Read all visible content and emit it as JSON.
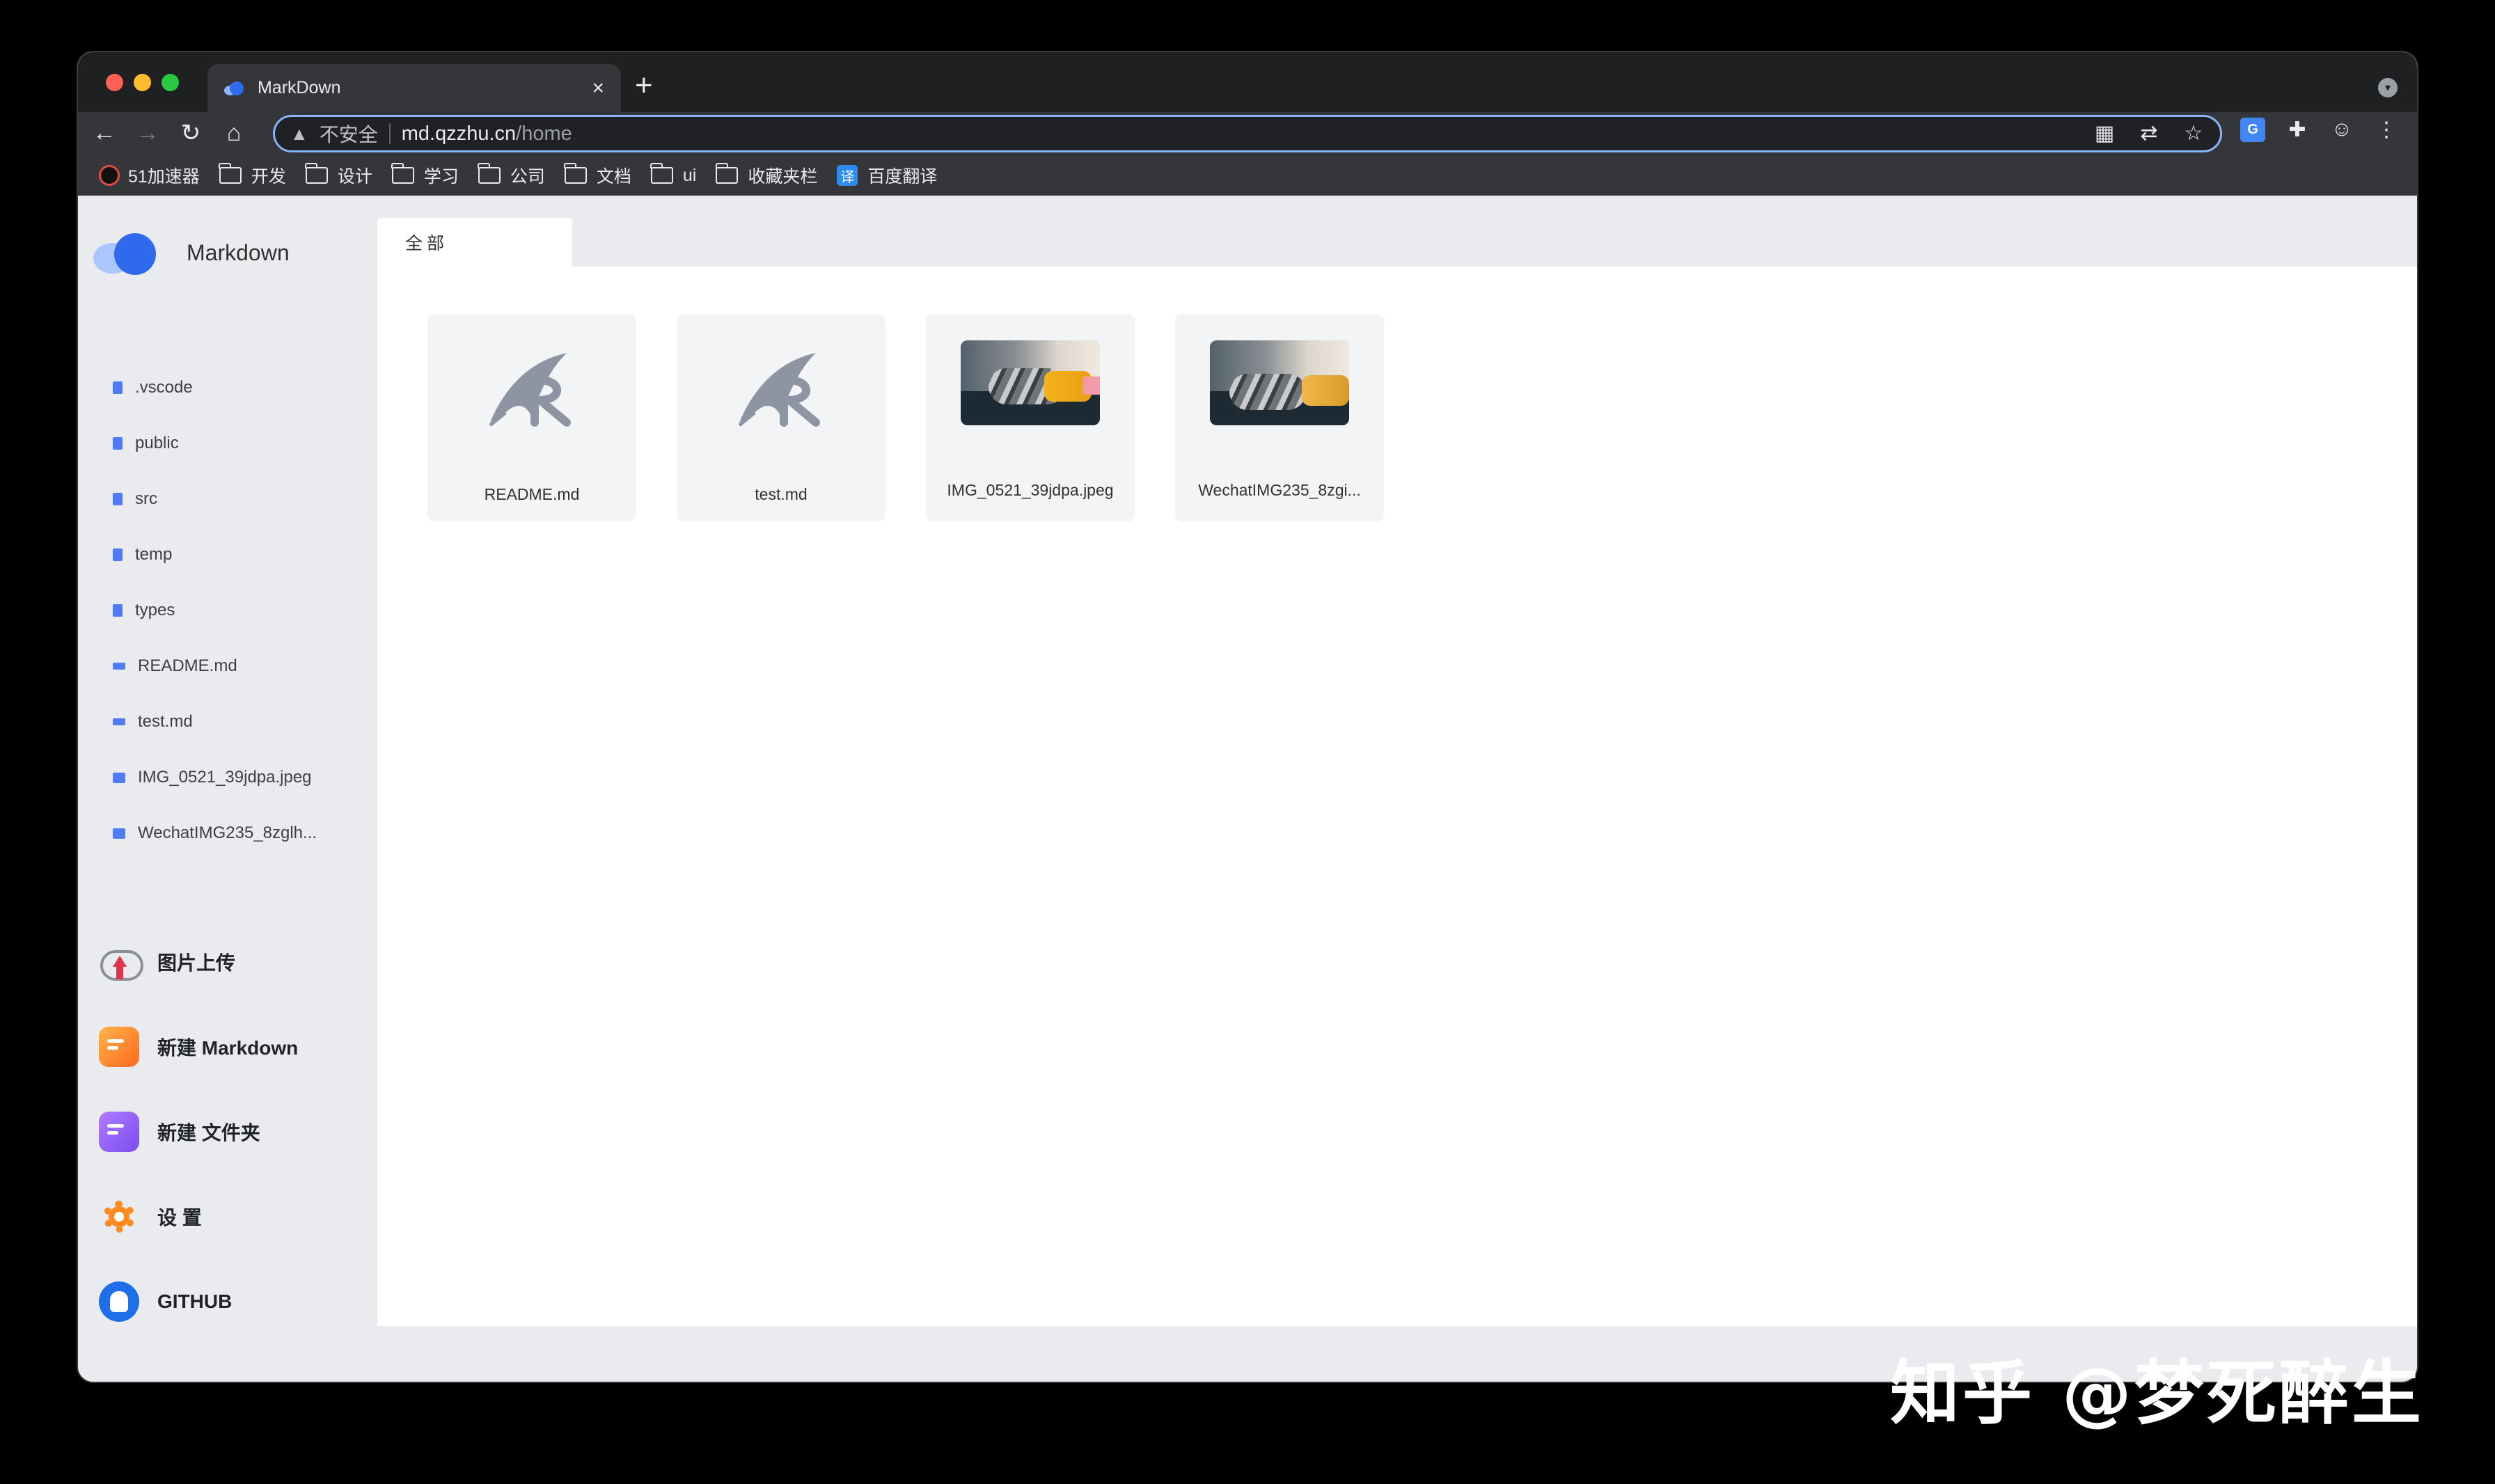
{
  "browser": {
    "tab_title": "MarkDown",
    "tab_close": "×",
    "new_tab": "+",
    "security_text": "不安全",
    "url_host": "md.qzzhu.cn",
    "url_path": "/home",
    "bookmarks": [
      {
        "label": "51加速器",
        "icon": "speed-icon"
      },
      {
        "label": "开发",
        "icon": "folder-icon"
      },
      {
        "label": "设计",
        "icon": "folder-icon"
      },
      {
        "label": "学习",
        "icon": "folder-icon"
      },
      {
        "label": "公司",
        "icon": "folder-icon"
      },
      {
        "label": "文档",
        "icon": "folder-icon"
      },
      {
        "label": "ui",
        "icon": "folder-icon"
      },
      {
        "label": "收藏夹栏",
        "icon": "folder-icon"
      },
      {
        "label": "百度翻译",
        "icon": "translate-icon"
      }
    ],
    "fanyi_glyph": "译"
  },
  "sidebar": {
    "app_title": "Markdown",
    "tree": [
      {
        "label": ".vscode",
        "icon": "file-icon"
      },
      {
        "label": "public",
        "icon": "file-icon"
      },
      {
        "label": "src",
        "icon": "file-icon"
      },
      {
        "label": "temp",
        "icon": "file-icon"
      },
      {
        "label": "types",
        "icon": "file-icon"
      },
      {
        "label": "README.md",
        "icon": "markdown-icon"
      },
      {
        "label": "test.md",
        "icon": "markdown-icon"
      },
      {
        "label": "IMG_0521_39jdpa.jpeg",
        "icon": "image-icon"
      },
      {
        "label": "WechatIMG235_8zglh...",
        "icon": "image-icon"
      }
    ],
    "actions": [
      {
        "label": "图片上传",
        "icon": "upload-icon"
      },
      {
        "label": "新建 Markdown",
        "icon": "new-markdown-icon"
      },
      {
        "label": "新建 文件夹",
        "icon": "new-folder-icon"
      },
      {
        "label": "设 置",
        "icon": "settings-icon"
      },
      {
        "label": "GITHUB",
        "icon": "github-icon"
      }
    ]
  },
  "main": {
    "tab_label": "全部",
    "files": [
      {
        "label": "README.md",
        "type": "markdown"
      },
      {
        "label": "test.md",
        "type": "markdown"
      },
      {
        "label": "IMG_0521_39jdpa.jpeg",
        "type": "image"
      },
      {
        "label": "WechatIMG235_8zgi...",
        "type": "image"
      }
    ]
  },
  "watermark": "知乎 @梦死醉生",
  "colors": {
    "accent": "#2e6bec",
    "file_icon": "#4f7cf6",
    "address_focus": "#8ab4f8"
  }
}
